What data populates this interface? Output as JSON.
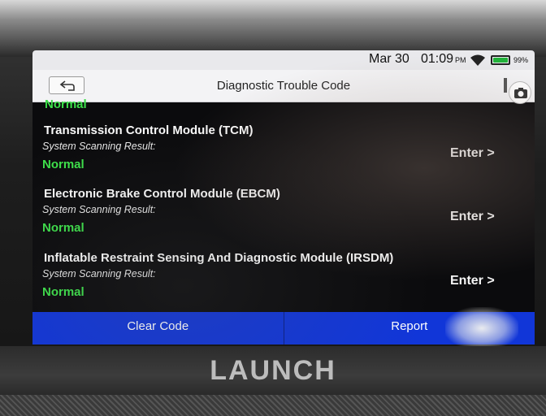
{
  "status_bar": {
    "date": "Mar 30",
    "time": "01:09",
    "ampm": "PM",
    "battery": "99%",
    "battery_level": 0.99,
    "icons": [
      "wifi-icon",
      "battery-icon"
    ]
  },
  "header": {
    "title": "Diagnostic Trouble Code",
    "back_icon": "back-arrow-icon",
    "menu_icon": "menu-icon",
    "camera_icon": "camera-icon"
  },
  "list": {
    "top_status": "Normal",
    "modules": [
      {
        "name": "Transmission Control Module (TCM)",
        "sub": "System Scanning Result:",
        "status": "Normal",
        "enter": "Enter >"
      },
      {
        "name": "Electronic Brake Control Module (EBCM)",
        "sub": "System Scanning Result:",
        "status": "Normal",
        "enter": "Enter >"
      },
      {
        "name": "Inflatable Restraint Sensing And Diagnostic Module (IRSDM)",
        "sub": "System Scanning Result:",
        "status": "Normal",
        "enter": "Enter >"
      }
    ]
  },
  "actions": {
    "clear_code": "Clear Code",
    "report": "Report"
  },
  "brand": "LAUNCH",
  "colors": {
    "status_normal": "#3de04a",
    "action_bar": "#1136d8",
    "screen_bg": "#0b0b0d"
  }
}
